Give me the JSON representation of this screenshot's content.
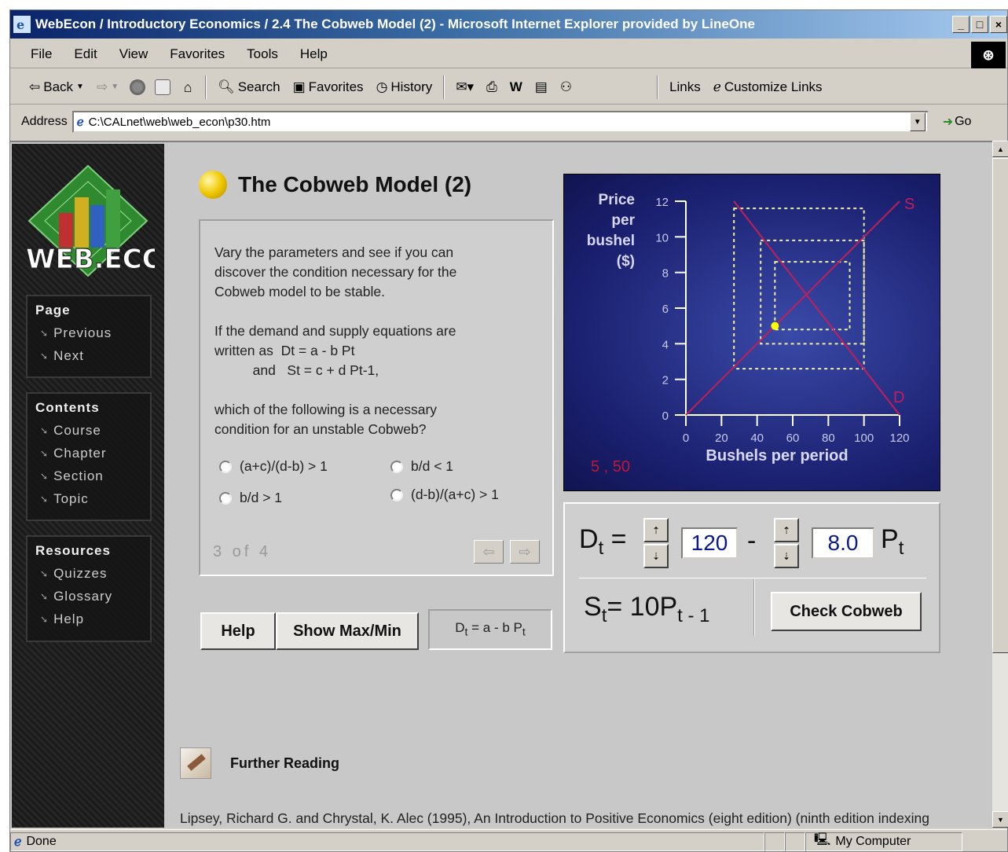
{
  "window": {
    "title": "WebEcon / Introductory Economics / 2.4 The Cobweb Model (2)    - Microsoft Internet Explorer provided by LineOne",
    "controls": [
      "_",
      "□",
      "×"
    ]
  },
  "menu": [
    "File",
    "Edit",
    "View",
    "Favorites",
    "Tools",
    "Help"
  ],
  "toolbar": {
    "back": "Back",
    "search": "Search",
    "favorites": "Favorites",
    "history": "History",
    "links": "Links",
    "customize_links": "Customize Links"
  },
  "address": {
    "label": "Address",
    "value": "C:\\CALnet\\web\\web_econ\\p30.htm",
    "go": "Go"
  },
  "sidebar": {
    "page": {
      "heading": "Page",
      "items": [
        "Previous",
        "Next"
      ]
    },
    "contents": {
      "heading": "Contents",
      "items": [
        "Course",
        "Chapter",
        "Section",
        "Topic"
      ]
    },
    "resources": {
      "heading": "Resources",
      "items": [
        "Quizzes",
        "Glossary",
        "Help"
      ]
    },
    "logo_text": "WEB.ECON"
  },
  "page": {
    "title": "The Cobweb Model (2)",
    "question": "Vary the parameters and see if you can\ndiscover the condition necessary for the\nCobweb model to be stable.\n\nIf the demand and supply equations are\nwritten as  Dt = a - b Pt\n          and   St = c + d Pt-1,\n\nwhich of the following is a necessary\ncondition for an unstable Cobweb?",
    "options": [
      "(a+c)/(d-b) > 1",
      "b/d < 1",
      "b/d > 1",
      "(d-b)/(a+c) > 1"
    ],
    "pager": "3  of  4",
    "buttons": {
      "help": "Help",
      "showmaxmin": "Show Max/Min",
      "check": "Check Cobweb"
    },
    "formula_box": "D = a - b P"
  },
  "chart_data": {
    "type": "line",
    "ylabel": "Price per bushel ($)",
    "xlabel": "Bushels per period",
    "xlim": [
      0,
      120
    ],
    "ylim": [
      0,
      12
    ],
    "x_ticks": [
      0,
      20,
      40,
      60,
      80,
      100,
      120
    ],
    "y_ticks": [
      0,
      2,
      4,
      6,
      8,
      10,
      12
    ],
    "series": [
      {
        "name": "S",
        "points": [
          [
            0,
            0
          ],
          [
            120,
            12
          ]
        ]
      },
      {
        "name": "D",
        "points": [
          [
            27,
            12
          ],
          [
            120,
            0
          ]
        ]
      }
    ],
    "cobweb_rectangles": [
      [
        27,
        2.6,
        100,
        11.6
      ],
      [
        42,
        4.0,
        100,
        9.8
      ],
      [
        50,
        4.8,
        92,
        8.6
      ]
    ],
    "current_point": [
      50,
      5.0
    ],
    "readout": "5 , 50",
    "axis_color": "#ffffff",
    "line_color": "#c0205a",
    "point_color": "#ffff00"
  },
  "equation": {
    "demand_prefix": "D",
    "demand_sub": "t",
    "a": "120",
    "minus": "-",
    "b": "8.0",
    "p": "P",
    "p_sub": "t",
    "supply": "S",
    "supply_sub": "t",
    "supply_rhs": "= 10P",
    "supply_rhs_sub": "t - 1"
  },
  "further_reading": {
    "heading": "Further Reading",
    "text": "Lipsey, Richard G. and Chrystal, K. Alec (1995), An Introduction to Positive Economics (eight edition) (ninth edition indexing coming soon). Oxford University Press, Oxford, UK. Note: Lipsey does not refer to the Cobweb model"
  },
  "status": {
    "left": "Done",
    "right": "My Computer"
  }
}
